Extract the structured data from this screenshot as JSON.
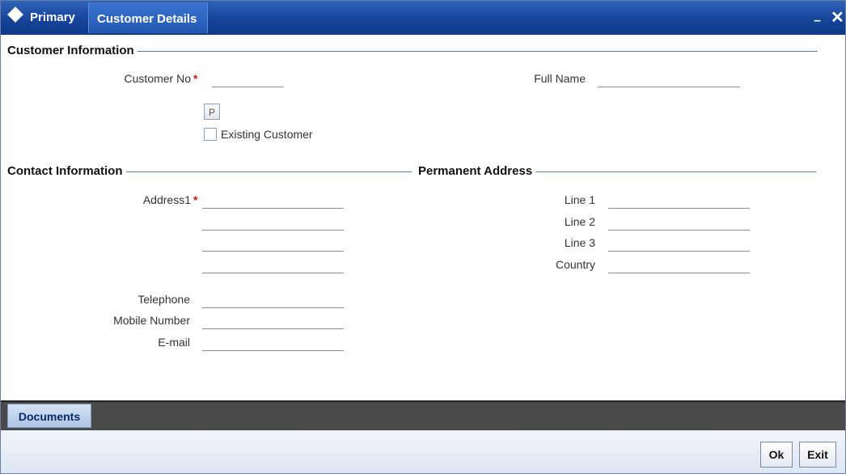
{
  "titlebar": {
    "tab_primary": "Primary",
    "tab_customer": "Customer Details",
    "minimize": "–",
    "close": "✕"
  },
  "customer_info": {
    "header": "Customer Information",
    "customer_no_label": "Customer No",
    "customer_no_value": "",
    "full_name_label": "Full Name",
    "full_name_value": "",
    "p_button": "P",
    "existing_customer_label": "Existing Customer",
    "existing_customer_checked": false
  },
  "contact_info": {
    "header": "Contact Information",
    "address1_label": "Address1",
    "address_lines": [
      "",
      "",
      "",
      ""
    ],
    "telephone_label": "Telephone",
    "telephone_value": "",
    "mobile_label": "Mobile Number",
    "mobile_value": "",
    "email_label": "E-mail",
    "email_value": ""
  },
  "permanent_address": {
    "header": "Permanent Address",
    "line1_label": "Line 1",
    "line2_label": "Line 2",
    "line3_label": "Line 3",
    "country_label": "Country",
    "line1_value": "",
    "line2_value": "",
    "line3_value": "",
    "country_value": ""
  },
  "required_marker": "*",
  "documents_button": "Documents",
  "footer": {
    "ok": "Ok",
    "exit": "Exit"
  },
  "colors": {
    "titlebar": "#1a4aa0",
    "required": "#d01010",
    "section_line": "#5b7fb3",
    "doc_bar": "#4a4a4a"
  }
}
